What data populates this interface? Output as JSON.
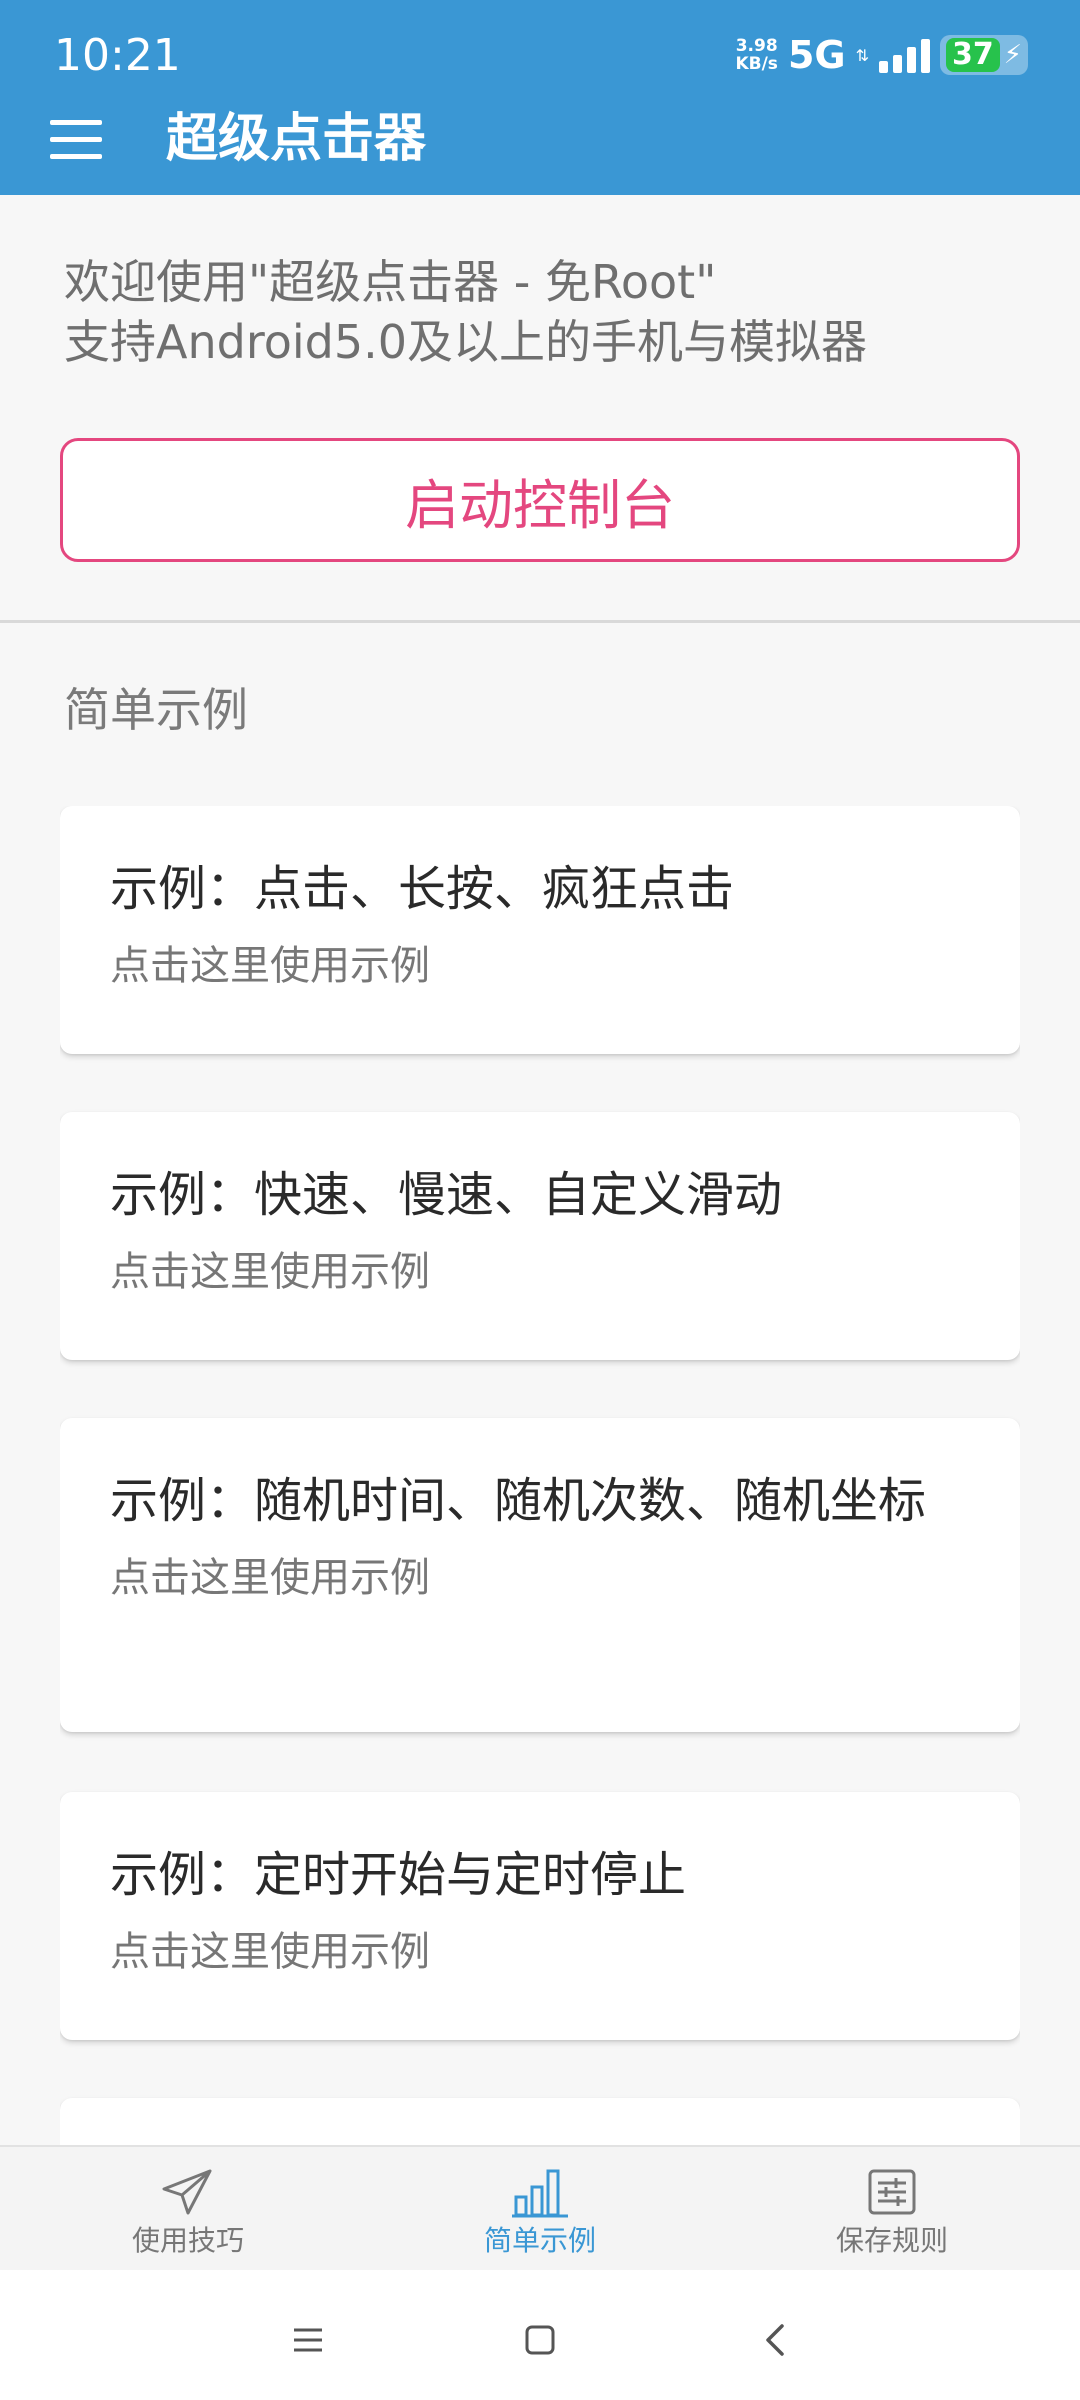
{
  "status_bar": {
    "time": "10:21",
    "net_speed_value": "3.98",
    "net_speed_unit": "KB/s",
    "network": "5G",
    "battery": "37"
  },
  "app_bar": {
    "title": "超级点击器",
    "menu_icon": "hamburger-menu-icon"
  },
  "welcome": {
    "line1": "欢迎使用\"超级点击器 - 免Root\"",
    "line2": "支持Android5.0及以上的手机与模拟器"
  },
  "start_button": {
    "label": "启动控制台"
  },
  "section_title": "简单示例",
  "cards": [
    {
      "title": "示例：点击、长按、疯狂点击",
      "subtitle": "点击这里使用示例"
    },
    {
      "title": "示例：快速、慢速、自定义滑动",
      "subtitle": "点击这里使用示例"
    },
    {
      "title": "示例：随机时间、随机次数、随机坐标",
      "subtitle": "点击这里使用示例"
    },
    {
      "title": "示例：定时开始与定时停止",
      "subtitle": "点击这里使用示例"
    }
  ],
  "bottom_nav": {
    "items": [
      {
        "label": "使用技巧",
        "icon": "paper-plane-icon",
        "active": false
      },
      {
        "label": "简单示例",
        "icon": "bar-chart-icon",
        "active": true
      },
      {
        "label": "保存规则",
        "icon": "sliders-icon",
        "active": false
      }
    ],
    "active_color": "#3a97d4",
    "inactive_color": "#777777"
  },
  "colors": {
    "primary": "#3a97d4",
    "accent": "#e4477f",
    "battery": "#27c24c"
  }
}
